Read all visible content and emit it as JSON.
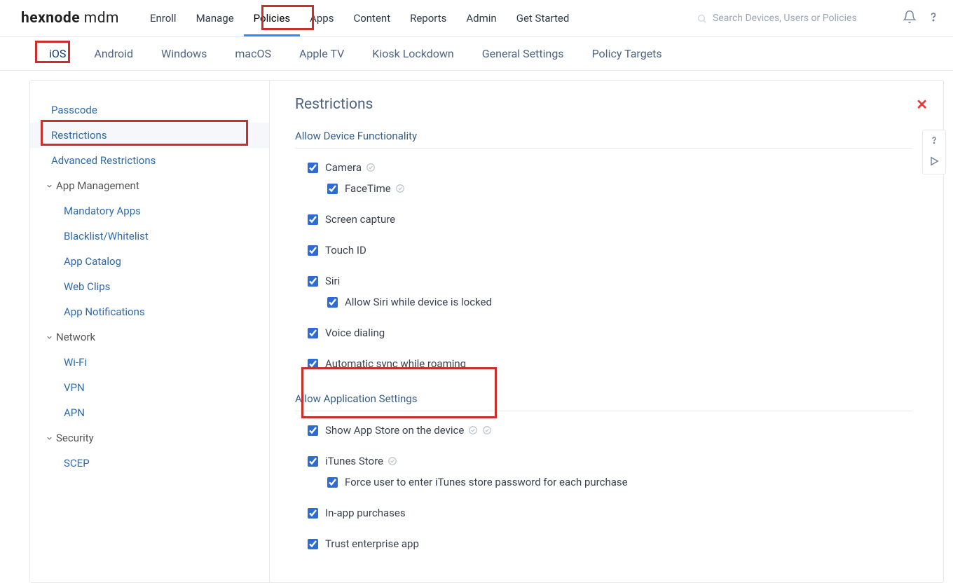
{
  "brand": {
    "name": "hexnode",
    "suffix": " mdm"
  },
  "topnav": [
    "Enroll",
    "Manage",
    "Policies",
    "Apps",
    "Content",
    "Reports",
    "Admin",
    "Get Started"
  ],
  "topnav_active": 2,
  "search": {
    "placeholder": "Search Devices, Users or Policies"
  },
  "subtabs": [
    "iOS",
    "Android",
    "Windows",
    "macOS",
    "Apple TV",
    "Kiosk Lockdown",
    "General Settings",
    "Policy Targets"
  ],
  "subtabs_active": 0,
  "sidebar": {
    "plain": [
      "Passcode",
      "Restrictions",
      "Advanced Restrictions"
    ],
    "selected_index": 1,
    "groups": [
      {
        "label": "App Management",
        "items": [
          "Mandatory Apps",
          "Blacklist/Whitelist",
          "App Catalog",
          "Web Clips",
          "App Notifications"
        ]
      },
      {
        "label": "Network",
        "items": [
          "Wi-Fi",
          "VPN",
          "APN"
        ]
      },
      {
        "label": "Security",
        "items": [
          "SCEP"
        ]
      }
    ]
  },
  "panel": {
    "title": "Restrictions",
    "sections": [
      {
        "title": "Allow Device Functionality",
        "rows": [
          {
            "label": "Camera",
            "checked": true,
            "info": true
          },
          {
            "label": "FaceTime",
            "checked": true,
            "info": true,
            "indent": true
          },
          {
            "label": "Screen capture",
            "checked": true,
            "gap_before": true
          },
          {
            "label": "Touch ID",
            "checked": true,
            "gap_before": true
          },
          {
            "label": "Siri",
            "checked": true,
            "gap_before": true
          },
          {
            "label": "Allow Siri while device is locked",
            "checked": true,
            "indent": true
          },
          {
            "label": "Voice dialing",
            "checked": true,
            "gap_before": true
          },
          {
            "label": "Automatic sync while roaming",
            "checked": true,
            "gap_before": true
          }
        ]
      },
      {
        "title": "Allow Application Settings",
        "rows": [
          {
            "label": "Show App Store on the device",
            "checked": true,
            "info": true,
            "info2": true
          },
          {
            "label": "iTunes Store",
            "checked": true,
            "info": true,
            "gap_before": true
          },
          {
            "label": "Force user to enter iTunes store password for each purchase",
            "checked": true,
            "indent": true
          },
          {
            "label": "In-app purchases",
            "checked": true,
            "gap_before": true
          },
          {
            "label": "Trust enterprise app",
            "checked": true,
            "gap_before": true
          }
        ]
      }
    ]
  }
}
